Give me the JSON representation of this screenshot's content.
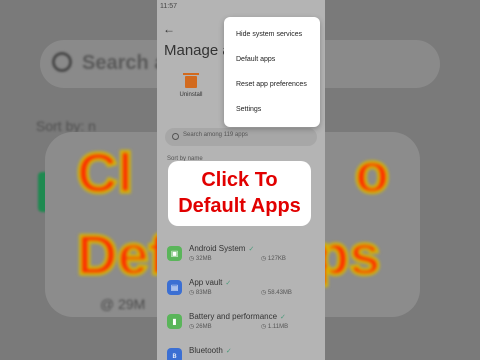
{
  "background": {
    "search_text": "Search a",
    "sort_text": "Sort by: n",
    "big_line1": "Cl",
    "big_line1b": "o",
    "big_line2": "Defa",
    "big_line2b": "ps",
    "bottom_text": "@ 29M"
  },
  "status": {
    "time": "11:57"
  },
  "header": {
    "title": "Manage apps"
  },
  "action": {
    "uninstall_label": "Uninstall"
  },
  "search": {
    "placeholder": "Search among 119 apps"
  },
  "sort": {
    "label": "Sort by name"
  },
  "apps": [
    {
      "name": "Android System",
      "size": "32MB",
      "data": "127KB",
      "color": "#5ab55a",
      "icon": "android-icon",
      "glyph": "▣"
    },
    {
      "name": "App vault",
      "size": "83MB",
      "data": "58.43MB",
      "color": "#3b6fd3",
      "icon": "app-vault-icon",
      "glyph": "▤"
    },
    {
      "name": "Battery and performance",
      "size": "26MB",
      "data": "1.11MB",
      "color": "#5ab55a",
      "icon": "battery-icon",
      "glyph": "▮"
    },
    {
      "name": "Bluetooth",
      "size": "",
      "data": "",
      "color": "#3b6fd3",
      "icon": "bluetooth-icon",
      "glyph": "ʙ"
    }
  ],
  "partial_row": {
    "size": "27MB",
    "data": "25KB"
  },
  "menu": {
    "items": [
      "Hide system services",
      "Default apps",
      "Reset app preferences",
      "Settings"
    ]
  },
  "callout": {
    "line1": "Click To",
    "line2": "Default Apps"
  },
  "colors": {
    "accent_red": "#e10000",
    "menu_bg": "#ffffff"
  }
}
